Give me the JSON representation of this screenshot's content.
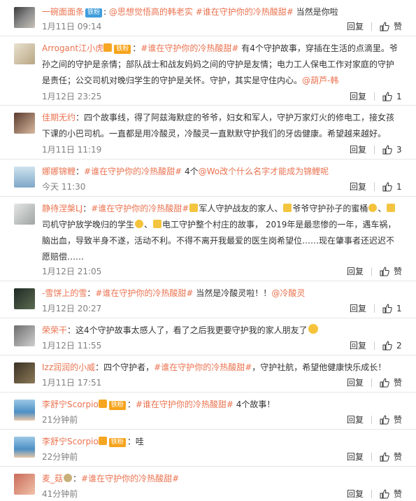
{
  "labels": {
    "reply": "回复",
    "like": "赞"
  },
  "comments": [
    {
      "user": "一碗面面条",
      "badge": "铁粉",
      "text_parts": [
        ": ",
        "@思想觉悟高的韩老实",
        " ",
        "#谁在守护你的冷热酸甜#",
        " 当然是你啦"
      ],
      "time": "1月11日 09:14",
      "likes": "赞"
    },
    {
      "user": "Arrogant江小虎",
      "badge": "铁粉",
      "text_parts": [
        "：",
        "#谁在守护你的冷热酸甜#",
        " 有4个守护故事，穿插在生活的点滴里。爷孙之间的守护是亲情；部队战士和战友妈妈之间的守护是友情；电力工人保电工作对家庭的守护是责任；公交司机对晚归学生的守护是关怀。守护，其实是守住内心。",
        "@葫芦-韩"
      ],
      "time": "1月12日 23:25",
      "likes": "1"
    },
    {
      "user": "佳期无约",
      "text_parts": [
        "：四个故事线，得了阿兹海默症的爷爷，妇女和军人，守护万家灯火的修电工，接女孩下课的小巴司机。一直都是用冷酸灵，冷酸灵一直默默守护我们的牙齿健康。希望越来越好。"
      ],
      "time": "1月11日 11:19",
      "likes": "3"
    },
    {
      "user": "娜娜锦鲤",
      "text_parts": [
        "：",
        "#谁在守护你的冷热酸甜#",
        " 4个",
        "@Wo改个什么名字才能成为锦鲤呢"
      ],
      "time": "今天 11:30",
      "likes": "1"
    },
    {
      "user": "静待涅槃LJ",
      "text_parts": [
        "：",
        "#谁在守护你的冷热酸甜#",
        "军人守护战友的家人、",
        "爷爷守护孙子的蜜桶",
        "、",
        "司机守护放学晚归的学生",
        "、",
        "电工守护整个村庄的故事， 2019年是最悲惨的一年，遇车祸，脑出血，导致半身不遂，活动不利。不得不离开我最爱的医生岗希望位……现在肇事者还迟迟不愿赔偿……"
      ],
      "time": "1月12日 21:05",
      "likes": "赞"
    },
    {
      "user": "-雪饼上的雪",
      "text_parts": [
        "：",
        "#谁在守护你的冷热酸甜#",
        " 当然是冷酸灵啦！！",
        "@冷酸灵"
      ],
      "time": "1月12日 20:27",
      "likes": "1"
    },
    {
      "user": "荣荣干",
      "text_parts": [
        "：这4个守护故事太感人了，看了之后我更要守护我的家人朋友了"
      ],
      "time": "1月12日 11:55",
      "likes": "2"
    },
    {
      "user": "Izz润润的小威",
      "text_parts": [
        "：四个守护者，",
        "#谁在守护你的冷热酸甜#",
        "，守护社航，希望他健康快乐成长！"
      ],
      "time": "1月11日 17:51",
      "likes": "赞"
    },
    {
      "user": "李舒宁Scorpio",
      "badge": "铁粉",
      "text_parts": [
        "：",
        "#谁在守护你的冷热酸甜#",
        " 4个故事！"
      ],
      "time": "21分钟前",
      "likes": "赞"
    },
    {
      "user": "李舒宁Scorpio",
      "badge": "铁粉",
      "text_parts": [
        "：哇"
      ],
      "time": "22分钟前",
      "likes": "赞"
    },
    {
      "user": "麦_菇",
      "text_parts": [
        "：",
        "#谁在守护你的冷热酸甜#"
      ],
      "time": "41分钟前",
      "likes": "赞"
    }
  ],
  "colors": {
    "accent": "#eb7350",
    "meta": "#808080",
    "badge_orange": "#f7a41d",
    "badge_blue": "#3f9ddc"
  }
}
